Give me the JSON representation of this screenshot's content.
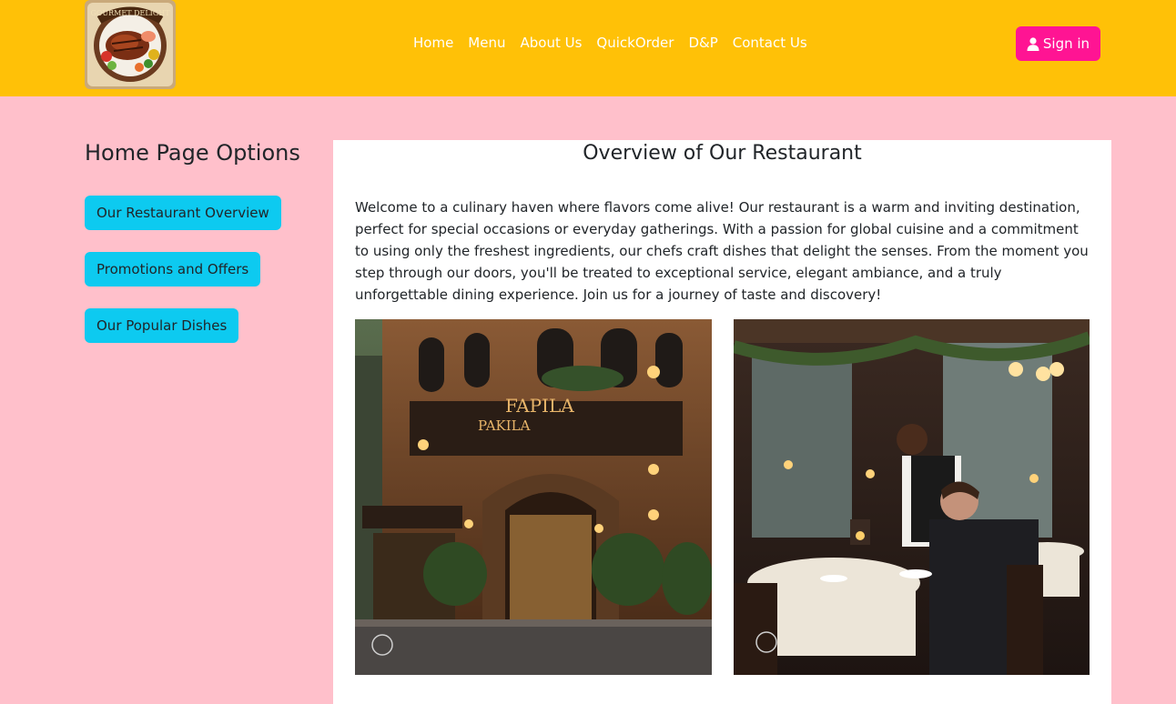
{
  "navbar": {
    "logo_alt": "Gourmet Delight",
    "logo_text": "GOURMET DELIGHT",
    "links": [
      "Home",
      "Menu",
      "About Us",
      "QuickOrder",
      "D&P",
      "Contact Us"
    ],
    "signin_label": "Sign in",
    "signin_icon": "user-icon"
  },
  "sidebar": {
    "title": "Home Page Options",
    "buttons": [
      "Our Restaurant Overview",
      "Promotions and Offers",
      "Our Popular Dishes"
    ]
  },
  "main": {
    "title": "Overview of Our Restaurant",
    "paragraph": "Welcome to a culinary haven where flavors come alive! Our restaurant is a warm and inviting destination, perfect for special occasions or everyday gatherings. With a passion for global cuisine and a commitment to using only the freshest ingredients, our chefs craft dishes that delight the senses. From the moment you step through our doors, you'll be treated to exceptional service, elegant ambiance, and a truly unforgettable dining experience. Join us for a journey of taste and discovery!",
    "images": [
      {
        "alt": "Restaurant exterior",
        "sign_top": "FAPILA",
        "sign_bottom": "PAKILA"
      },
      {
        "alt": "Restaurant interior with waiter serving a guest"
      }
    ]
  },
  "colors": {
    "navbar_bg": "#ffc107",
    "page_bg": "#ffc0cb",
    "signin_bg": "#ff1493",
    "side_button_bg": "#0dcaf0"
  }
}
